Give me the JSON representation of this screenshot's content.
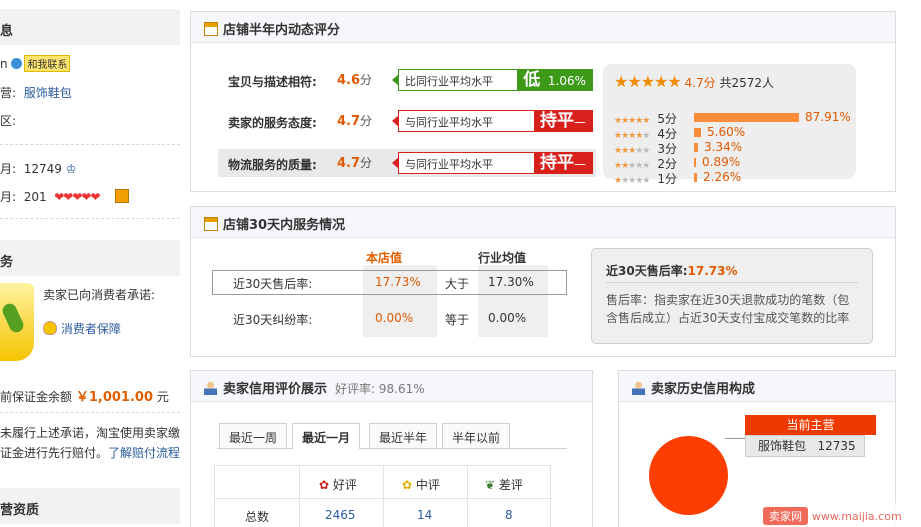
{
  "left": {
    "info_title": "息",
    "contact_prefix": "n",
    "contact_label": "和我联系",
    "main_label": "营:",
    "main_value": "服饰鞋包",
    "area_label": "区:",
    "rate1_label": "月:",
    "rate1_value": "12749",
    "rate2_label": "月:",
    "rate2_value": "201",
    "service_title": "务",
    "promise_text": "卖家已向消费者承诺:",
    "protection_link": "消费者保障",
    "deposit_text": "前保证金余额",
    "deposit_amount": "￥1,001.00",
    "deposit_unit": "元",
    "note_line1": "未履行上述承诺，淘宝使用卖家缴",
    "note_line2": "证金进行先行赔付。",
    "note_link": "了解赔付流程",
    "qual_title": "营资质"
  },
  "rating_panel": {
    "title": "店铺半年内动态评分",
    "rows": [
      {
        "label": "宝贝与描述相符:",
        "score": "4.6",
        "unit": "分",
        "compare": "比同行业平均水平",
        "big": "低",
        "small": "1.06%",
        "color": "#3d9a18"
      },
      {
        "label": "卖家的服务态度:",
        "score": "4.7",
        "unit": "分",
        "compare": "与同行业平均水平",
        "big": "持平",
        "small": "—",
        "color": "#d8201c"
      },
      {
        "label": "物流服务的质量:",
        "score": "4.7",
        "unit": "分",
        "compare": "与同行业平均水平",
        "big": "持平",
        "small": "—",
        "color": "#d8201c"
      }
    ],
    "summary": {
      "score": "4.7分",
      "count_text": "共2572人"
    },
    "distribution": [
      {
        "label": "5分",
        "pct": "87.91%",
        "value": 87.91
      },
      {
        "label": "4分",
        "pct": "5.60%",
        "value": 5.6
      },
      {
        "label": "3分",
        "pct": "3.34%",
        "value": 3.34
      },
      {
        "label": "2分",
        "pct": "0.89%",
        "value": 0.89
      },
      {
        "label": "1分",
        "pct": "2.26%",
        "value": 2.26
      }
    ]
  },
  "service_panel": {
    "title": "店铺30天内服务情况",
    "col_store": "本店值",
    "col_industry": "行业均值",
    "rows": [
      {
        "label": "近30天售后率:",
        "store": "17.73%",
        "cmp": "大于",
        "industry": "17.30%"
      },
      {
        "label": "近30天纠纷率:",
        "store": "0.00%",
        "cmp": "等于",
        "industry": "0.00%"
      }
    ],
    "explain_title": "近30天售后率:",
    "explain_value": "17.73%",
    "explain_text_1": "售后率：指卖家在近30天退款成功的笔数（包",
    "explain_text_2": "含售后成立）占近30天支付宝成交笔数的比率"
  },
  "credit_panel": {
    "title": "卖家信用评价展示",
    "rate_text": "好评率: 98.61%",
    "tabs": [
      "最近一周",
      "最近一月",
      "最近半年",
      "半年以前"
    ],
    "active_tab": 1,
    "headers": [
      "好评",
      "中评",
      "差评"
    ],
    "row_label": "总数",
    "row_values": [
      "2465",
      "14",
      "8"
    ]
  },
  "history_panel": {
    "title": "卖家历史信用构成",
    "main_label": "当前主营",
    "category": "服饰鞋包",
    "category_count": "12735"
  },
  "watermark": {
    "brand": "卖家网",
    "url": "www.maijia.com"
  }
}
